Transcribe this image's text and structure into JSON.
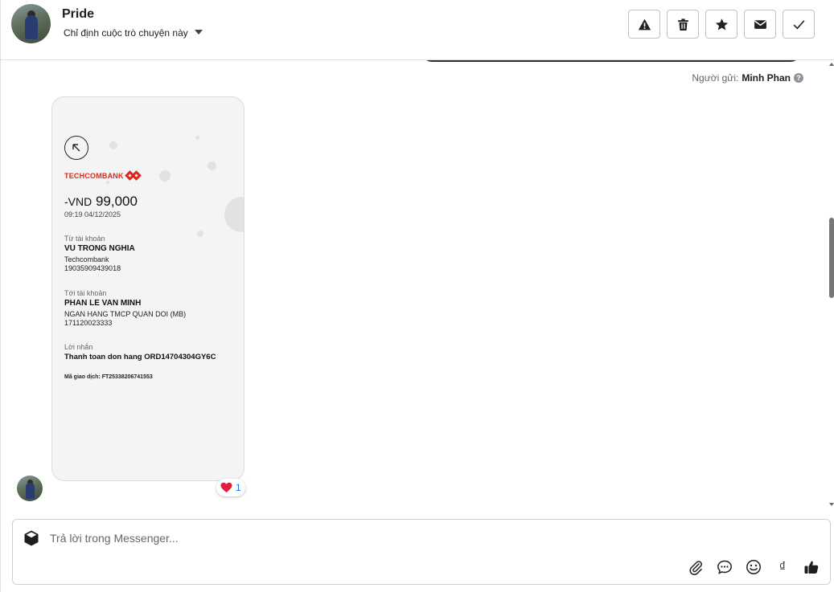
{
  "header": {
    "name": "Pride",
    "assign_label": "Chỉ định cuộc trò chuyện này",
    "actions": [
      "warning-icon",
      "trash-icon",
      "star-icon",
      "envelope-icon",
      "check-icon"
    ]
  },
  "conversation": {
    "sender_prefix": "Người gửi:",
    "sender_name": "Minh Phan",
    "sender_help": "?",
    "receipt": {
      "bank": "TECHCOMBANK",
      "currency": "-VND",
      "amount": "99,000",
      "time": "09:19 04/12/2025",
      "from_label": "Từ tài khoản",
      "from_name": "VU TRONG NGHIA",
      "from_bank": "Techcombank",
      "from_account": "19035909439018",
      "to_label": "Tới tài khoản",
      "to_name": "PHAN LE VAN MINH",
      "to_bank": "NGAN HANG TMCP QUAN DOI (MB)",
      "to_account": "171120023333",
      "note_label": "Lời nhắn",
      "note": "Thanh toan don hang ORD14704304GY6C",
      "txn_label": "Mã giao dịch:",
      "txn_id": "FT25338206741553"
    },
    "reaction": {
      "emoji": "heart-icon",
      "count": "1"
    }
  },
  "composer": {
    "placeholder": "Trả lời trong Messenger...",
    "tools": [
      "paperclip-icon",
      "chat-bubble-icon",
      "smiley-icon",
      "dong-icon",
      "thumbs-up-icon"
    ],
    "currency_symbol": "₫"
  },
  "colors": {
    "brand_red": "#e0261a",
    "reaction_count": "#1877f2",
    "border": "#dddfe2"
  }
}
